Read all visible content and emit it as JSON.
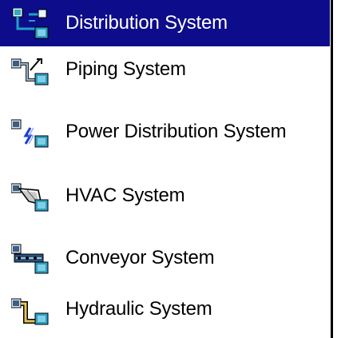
{
  "items": [
    {
      "label": "Distribution System",
      "icon": "distribution-system-icon",
      "selected": true
    },
    {
      "label": "Piping System",
      "icon": "piping-system-icon",
      "selected": false
    },
    {
      "label": "Power Distribution System",
      "icon": "power-distribution-system-icon",
      "selected": false
    },
    {
      "label": "HVAC System",
      "icon": "hvac-system-icon",
      "selected": false
    },
    {
      "label": "Conveyor System",
      "icon": "conveyor-system-icon",
      "selected": false
    },
    {
      "label": "Hydraulic System",
      "icon": "hydraulic-system-icon",
      "selected": false
    }
  ],
  "colors": {
    "selection": "#0d0c8a",
    "icon_blue": "#1fa0c7",
    "icon_teal": "#2bb3b3",
    "icon_dark": "#0f2f5f"
  }
}
